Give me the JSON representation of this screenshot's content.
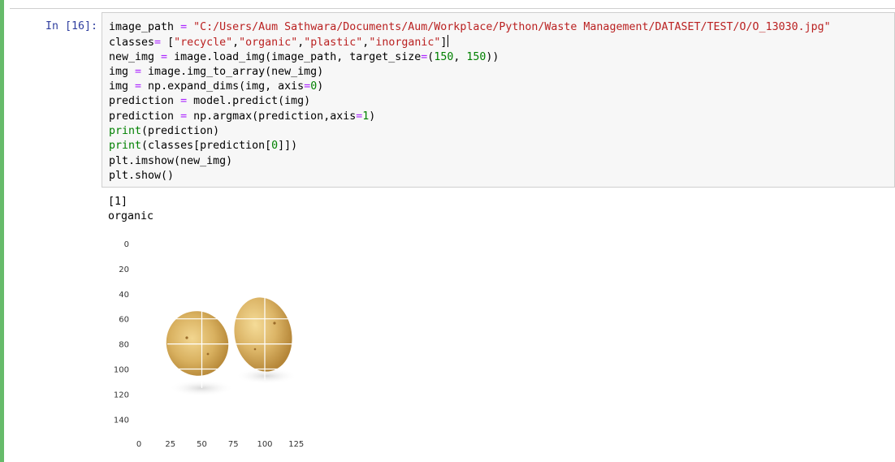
{
  "cell": {
    "prompt": "In [16]:",
    "code_lines": [
      [
        {
          "t": "image_path "
        },
        {
          "t": "=",
          "c": "kw-op"
        },
        {
          "t": " "
        },
        {
          "t": "\"C:/Users/Aum Sathwara/Documents/Aum/Workplace/Python/Waste Management/DATASET/TEST/O/O_13030.jpg\"",
          "c": "kw-str"
        }
      ],
      [
        {
          "t": "classes"
        },
        {
          "t": "=",
          "c": "kw-op"
        },
        {
          "t": " ["
        },
        {
          "t": "\"recycle\"",
          "c": "kw-str"
        },
        {
          "t": ","
        },
        {
          "t": "\"organic\"",
          "c": "kw-str"
        },
        {
          "t": ","
        },
        {
          "t": "\"plastic\"",
          "c": "kw-str"
        },
        {
          "t": ","
        },
        {
          "t": "\"inorganic\"",
          "c": "kw-str"
        },
        {
          "t": "]"
        }
      ],
      [
        {
          "t": "new_img "
        },
        {
          "t": "=",
          "c": "kw-op"
        },
        {
          "t": " image.load_img(image_path, target_size"
        },
        {
          "t": "=",
          "c": "kw-op"
        },
        {
          "t": "("
        },
        {
          "t": "150",
          "c": "kw-num"
        },
        {
          "t": ", "
        },
        {
          "t": "150",
          "c": "kw-num"
        },
        {
          "t": "))"
        }
      ],
      [
        {
          "t": "img "
        },
        {
          "t": "=",
          "c": "kw-op"
        },
        {
          "t": " image.img_to_array(new_img)"
        }
      ],
      [
        {
          "t": "img "
        },
        {
          "t": "=",
          "c": "kw-op"
        },
        {
          "t": " np.expand_dims(img, axis"
        },
        {
          "t": "=",
          "c": "kw-op"
        },
        {
          "t": "0",
          "c": "kw-num"
        },
        {
          "t": ")"
        }
      ],
      [
        {
          "t": "prediction "
        },
        {
          "t": "=",
          "c": "kw-op"
        },
        {
          "t": " model.predict(img)"
        }
      ],
      [
        {
          "t": "prediction "
        },
        {
          "t": "=",
          "c": "kw-op"
        },
        {
          "t": " np.argmax(prediction,axis"
        },
        {
          "t": "=",
          "c": "kw-op"
        },
        {
          "t": "1",
          "c": "kw-num"
        },
        {
          "t": ")"
        }
      ],
      [
        {
          "t": "print",
          "c": "kw-builtin"
        },
        {
          "t": "(prediction)"
        }
      ],
      [
        {
          "t": "print",
          "c": "kw-builtin"
        },
        {
          "t": "(classes[prediction["
        },
        {
          "t": "0",
          "c": "kw-num"
        },
        {
          "t": "]])"
        }
      ],
      [
        {
          "t": "plt.imshow(new_img)"
        }
      ],
      [
        {
          "t": "plt.show()"
        }
      ]
    ]
  },
  "output": {
    "lines": [
      "[1]",
      "organic"
    ]
  },
  "plot": {
    "image_subject": "two-potatoes-image",
    "y_ticks": [
      "0",
      "20",
      "40",
      "60",
      "80",
      "100",
      "120",
      "140"
    ],
    "x_ticks": [
      "0",
      "25",
      "50",
      "75",
      "100",
      "125"
    ]
  },
  "colors": {
    "cell_edge": "#66bb6a",
    "prompt": "#303f9f",
    "string": "#ba2121",
    "operator": "#aa22ff",
    "number": "#008000"
  }
}
